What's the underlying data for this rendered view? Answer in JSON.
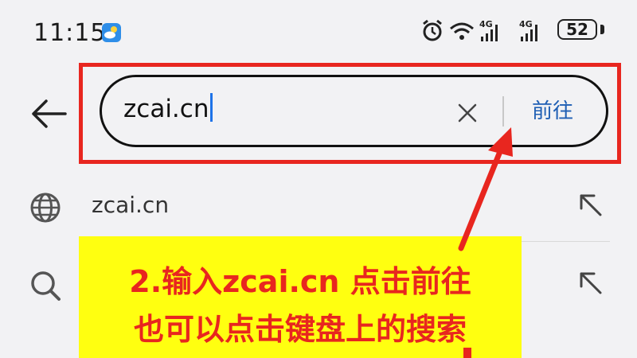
{
  "status_bar": {
    "time": "11:15",
    "network_1": "4G",
    "network_2": "4G",
    "battery": "52",
    "icons": [
      "weather-icon",
      "alarm-icon",
      "wifi-icon",
      "signal-icon",
      "signal-icon",
      "battery-icon"
    ]
  },
  "search": {
    "value": "zcai.cn",
    "go_label": "前往"
  },
  "suggestions": [
    {
      "text": "zcai.cn",
      "icon": "globe-icon"
    },
    {
      "text": "",
      "icon": "search-icon"
    }
  ],
  "annotation": {
    "line1": "2.输入zcai.cn 点击前往",
    "line2": "也可以点击键盘上的搜索",
    "color": "#e8261f",
    "background": "#ffff10"
  }
}
